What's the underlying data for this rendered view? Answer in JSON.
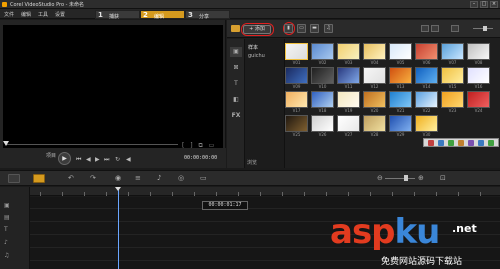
{
  "title_bar": {
    "title": "Corel VideoStudio Pro - 未命名",
    "minimize": "–",
    "maximize": "□",
    "close": "×"
  },
  "menu": {
    "items": [
      "文件",
      "编辑",
      "工具",
      "设置"
    ]
  },
  "steps": [
    {
      "num": "1",
      "label": "捕获"
    },
    {
      "num": "2",
      "label": "编辑"
    },
    {
      "num": "3",
      "label": "分享"
    }
  ],
  "preview": {
    "mode_label": "项目",
    "timecode": "00:00:00:00",
    "transport_icons": [
      "play-icon",
      "to-start-icon",
      "prev-frame-icon",
      "next-frame-icon",
      "to-end-icon",
      "repeat-icon",
      "volume-icon"
    ]
  },
  "library": {
    "add_label": "+ 添加",
    "folders": [
      "样本",
      "guichu"
    ],
    "browse_label": "浏览",
    "side_tabs": [
      "media-icon",
      "transition-icon",
      "title-icon",
      "graphic-icon",
      "fx-icon"
    ],
    "fx_label": "FX",
    "title_glyph": "T",
    "thumb_labels": [
      "V01",
      "V02",
      "V03",
      "V04",
      "V05",
      "V06",
      "V07",
      "V08",
      "V09",
      "V10",
      "V11",
      "V12",
      "V13",
      "V14",
      "V15",
      "V16",
      "V17",
      "V18",
      "V19",
      "V20",
      "V21",
      "V22",
      "V23",
      "V24",
      "V25",
      "V26",
      "V27",
      "V28",
      "V29",
      "V30"
    ]
  },
  "timeline": {
    "timecode": "00:00:01:17"
  },
  "watermark": {
    "text_a": "asp",
    "text_b": "ku",
    "net": ".net",
    "sub": "免费网站源码下载站"
  },
  "colors": {
    "accent": "#d59a1e",
    "annotation": "#e02020"
  }
}
